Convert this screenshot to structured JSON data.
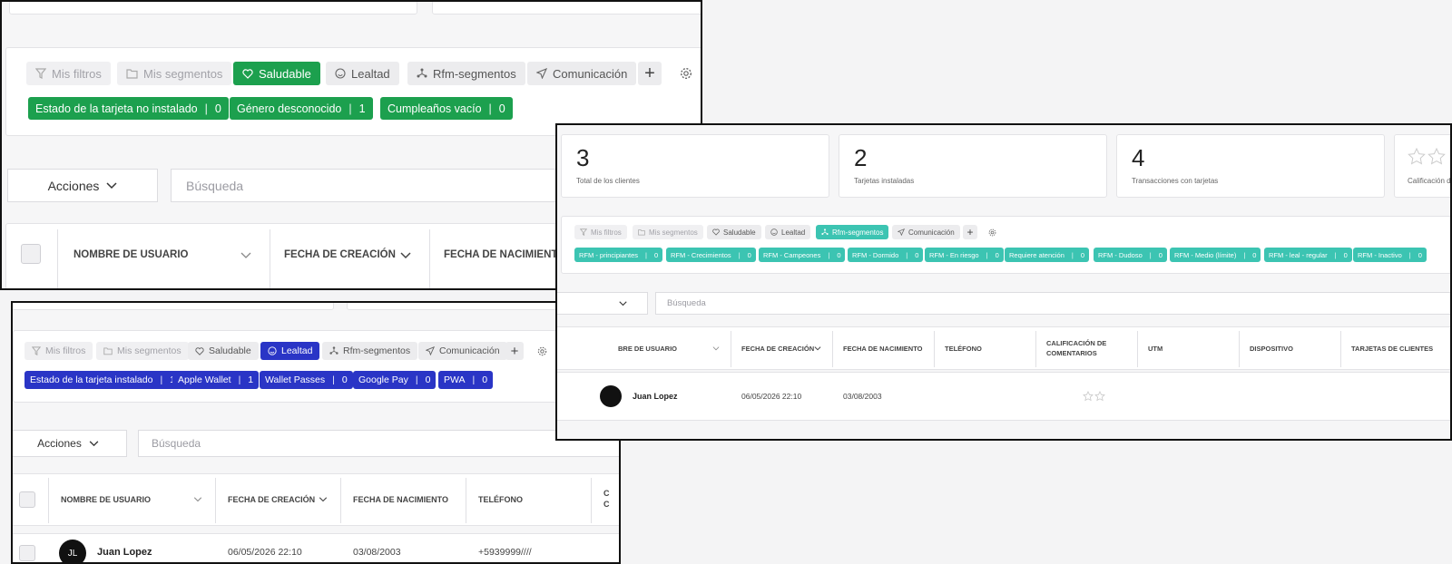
{
  "colors": {
    "green": "#1ca04e",
    "teal": "#3cc4b2",
    "blue": "#2a35c6"
  },
  "chips": {
    "mis_filtros": "Mis filtros",
    "mis_segmentos": "Mis segmentos",
    "saludable": "Saludable",
    "lealtad": "Lealtad",
    "rfm": "Rfm-segmentos",
    "comunicacion": "Comunicación"
  },
  "panel1": {
    "tags": [
      {
        "label": "Estado de la tarjeta no instalado",
        "count": "0"
      },
      {
        "label": "Género desconocido",
        "count": "1"
      },
      {
        "label": "Cumpleaños vacío",
        "count": "0"
      }
    ],
    "acciones": "Acciones",
    "search_placeholder": "Búsqueda",
    "headers": [
      "NOMBRE DE USUARIO",
      "FECHA DE CREACIÓN",
      "FECHA DE NACIMIENTO"
    ]
  },
  "panel2": {
    "stats": [
      {
        "value": "3",
        "label": "Total de los clientes"
      },
      {
        "value": "2",
        "label": "Tarjetas instaladas"
      },
      {
        "value": "4",
        "label": "Transacciones con tarjetas"
      },
      {
        "value": "",
        "label": "Calificación de"
      }
    ],
    "tags": [
      {
        "label": "RFM - principiantes",
        "count": "0"
      },
      {
        "label": "RFM - Crecimientos",
        "count": "0"
      },
      {
        "label": "RFM - Campeones",
        "count": "0"
      },
      {
        "label": "RFM - Dormido",
        "count": "0"
      },
      {
        "label": "RFM - En riesgo",
        "count": "0"
      },
      {
        "label": "Requiere atención",
        "count": "0"
      },
      {
        "label": "RFM - Dudoso",
        "count": "0"
      },
      {
        "label": "RFM - Medio (límite)",
        "count": "0"
      },
      {
        "label": "RFM - leal - regular",
        "count": "0"
      },
      {
        "label": "RFM - Inactivo",
        "count": "0"
      }
    ],
    "search_placeholder": "Búsqueda",
    "headers": [
      "BRE DE USUARIO",
      "FECHA DE CREACIÓN",
      "FECHA DE NACIMIENTO",
      "TELÉFONO",
      "CALIFICACIÓN DE",
      "COMENTARIOS",
      "UTM",
      "DISPOSITIVO",
      "TARJETAS DE CLIENTES"
    ],
    "row": {
      "name": "Juan Lopez",
      "created": "06/05/2026 22:10",
      "birth": "03/08/2003"
    }
  },
  "panel3": {
    "tags": [
      {
        "label": "Estado de la tarjeta instalado",
        "count": "1"
      },
      {
        "label": "Apple Wallet",
        "count": "1"
      },
      {
        "label": "Wallet Passes",
        "count": "0"
      },
      {
        "label": "Google Pay",
        "count": "0"
      },
      {
        "label": "PWA",
        "count": "0"
      }
    ],
    "acciones": "Acciones",
    "search_placeholder": "Búsqueda",
    "headers": [
      "NOMBRE DE USUARIO",
      "FECHA DE CREACIÓN",
      "FECHA DE NACIMIENTO",
      "TELÉFONO",
      "C",
      "C"
    ],
    "row": {
      "avatar": "JL",
      "name": "Juan Lopez",
      "created": "06/05/2026 22:10",
      "birth": "03/08/2003",
      "phone": "+5939999////"
    }
  }
}
